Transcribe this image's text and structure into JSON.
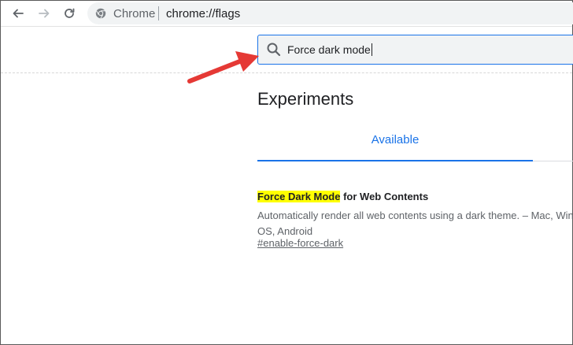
{
  "browser": {
    "site_label": "Chrome",
    "url": "chrome://flags"
  },
  "search": {
    "value": "Force dark mode"
  },
  "page": {
    "title": "Experiments",
    "tab_available": "Available"
  },
  "flag": {
    "title_highlight": "Force Dark Mode",
    "title_rest": " for Web Contents",
    "description_line1": "Automatically render all web contents using a dark theme. – Mac, Win",
    "description_line2": "OS, Android",
    "link": "#enable-force-dark"
  },
  "colors": {
    "accent": "#1a73e8",
    "highlight": "#ffff00",
    "arrow": "#e53935"
  }
}
